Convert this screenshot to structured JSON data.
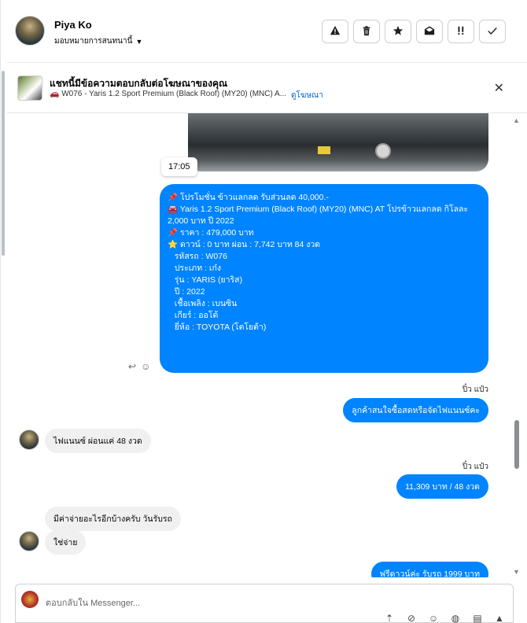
{
  "header": {
    "name": "Piya Ko",
    "assign_label": "มอบหมายการสนทนานี้"
  },
  "banner": {
    "title": "แชทนี้มีข้อความตอบกลับต่อโฆษณาของคุณ",
    "subtitle": "🚗 W076 - Yaris 1.2 Sport Premium (Black Roof) (MY20) (MNC) A...",
    "link": "ดูโฆษณา"
  },
  "messages": {
    "time": "17:05",
    "promo_lines": [
      "📌 โปรโมชั่น ข้าวแลกลด รับส่วนลด 40,000.-",
      "",
      "🚘 Yaris 1.2 Sport Premium (Black Roof) (MY20) (MNC) AT โปรข้าวแลกลด กิโลละ 2,000 บาท ปี 2022",
      "",
      "📌 ราคา : 479,000 บาท",
      "⭐ ดาวน์ : 0 บาท ผ่อน : 7,742 บาท 84 งวด",
      "",
      "   รหัสรถ : W076",
      "   ประเภท : เก๋ง",
      "   รุ่น : YARIS (ยาริส)",
      "   ปี : 2022",
      "   เชื้อเพลิง : เบนซิน",
      "   เกียร์ : ออโต้",
      "   ยี่ห้อ : TOYOTA (โตโยต้า)"
    ],
    "sender1": "ปิ๋ว แป๋ว",
    "out1": "ลูกค้าสนใจซื้อสดหรือจัดไฟแนนซ์คะ",
    "in1": "ไฟแนนซ์ ผ่อนแค่ 48 งวด",
    "sender2": "ปิ๋ว แป๋ว",
    "out2": "11,309 บาท    / 48 งวด",
    "in2": "มีค่าจ่ายอะไรอีกบ้างครับ วันรับรถ",
    "in3": "ใช่จ่าย",
    "out3": "ฟรีดาวน์ค่ะ  รับรถ 1999 บาท"
  },
  "composer": {
    "placeholder": "ตอบกลับใน Messenger..."
  },
  "icons": [
    "warning-icon",
    "trash-icon",
    "star-icon",
    "mail-open-icon",
    "important-icon",
    "check-icon",
    "close-icon",
    "reply-icon",
    "emoji-icon"
  ]
}
